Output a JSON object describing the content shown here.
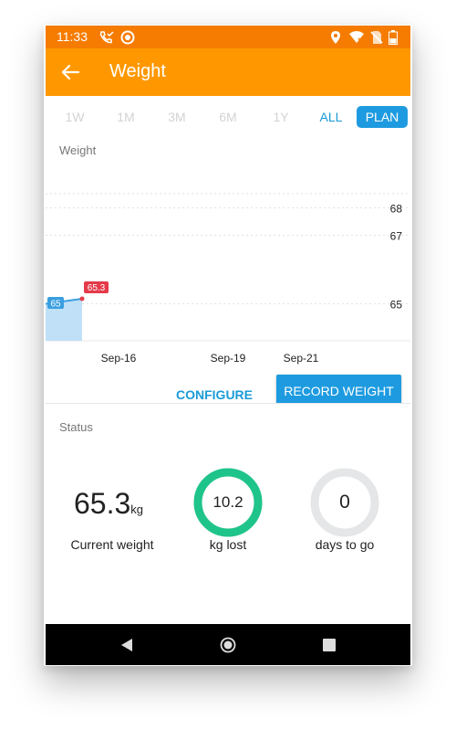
{
  "status_bar": {
    "time": "11:33"
  },
  "app_bar": {
    "title": "Weight"
  },
  "tabs": [
    {
      "label": "1W"
    },
    {
      "label": "1M"
    },
    {
      "label": "3M"
    },
    {
      "label": "6M"
    },
    {
      "label": "1Y"
    },
    {
      "label": "ALL"
    },
    {
      "label": "PLAN"
    }
  ],
  "active_tab": "PLAN",
  "chart_section": {
    "label": "Weight"
  },
  "chart_data": {
    "type": "area",
    "title": "",
    "y_ticks": [
      68,
      67,
      65
    ],
    "x_ticks": [
      "Sep-16",
      "Sep-19",
      "Sep-21"
    ],
    "series": [
      {
        "points": [
          {
            "x": "Sep-15",
            "y": 65
          },
          {
            "x": "Sep-16",
            "y": 65.3
          }
        ]
      }
    ],
    "point_labels": [
      "65",
      "65.3"
    ],
    "grid": true
  },
  "actions": {
    "configure_label": "CONFIGURE",
    "record_label": "RECORD WEIGHT"
  },
  "status": {
    "label": "Status",
    "current_weight": {
      "value": "65.3",
      "unit": "kg",
      "caption": "Current weight"
    },
    "kg_lost": {
      "value": "10.2",
      "caption": "kg lost",
      "progress": 1.0
    },
    "days_to_go": {
      "value": "0",
      "caption": "days to go",
      "progress": 0.0
    }
  },
  "colors": {
    "status_bar": "#f57c00",
    "app_bar": "#ff9800",
    "accent": "#1e9be0",
    "ring_progress": "#1fc48a",
    "ring_track": "#e4e6e8",
    "point_label_start": "#3a9fe0",
    "point_label_end": "#e43a4a"
  }
}
